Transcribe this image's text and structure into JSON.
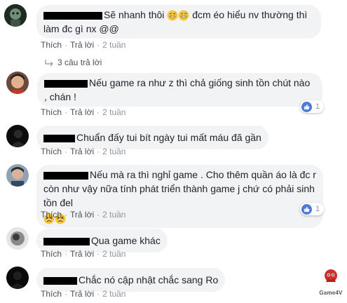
{
  "actions": {
    "like": "Thích",
    "reply": "Trả lời",
    "separator": "·"
  },
  "comments": [
    {
      "text": "Sẽ nhanh thôi",
      "text_after_emoji": "đcm éo hiểu nv thường thì làm đc gì nx @@",
      "time": "2 tuần",
      "replies_label": "3 câu trả lời"
    },
    {
      "text": "Nếu game ra như z thì chả giống sinh tồn chút nào , chán !",
      "time": "2 tuần",
      "reaction_count": "1"
    },
    {
      "text": "Chuẩn đấy tui bít ngày tui mất máu đã gần",
      "time": "2 tuần"
    },
    {
      "text": "Nếu mà ra thì nghỉ game . Cho thêm quần áo là đc r còn như vậy nữa tính phát triển thành game j chứ có phải sinh tồn đel",
      "time": "2 tuần",
      "reaction_count": "1"
    },
    {
      "text": "Qua game khác",
      "time": "2 tuần"
    },
    {
      "text": "Chắc nó cập nhật chắc sang Ro",
      "time": "2 tuần"
    }
  ],
  "watermark": {
    "label": "Game4V"
  },
  "colors": {
    "bubble": "#f2f3f5",
    "link": "#4b4f56",
    "meta": "#90949c",
    "like_blue": "#4c7bd9",
    "redaction": "#000000"
  }
}
